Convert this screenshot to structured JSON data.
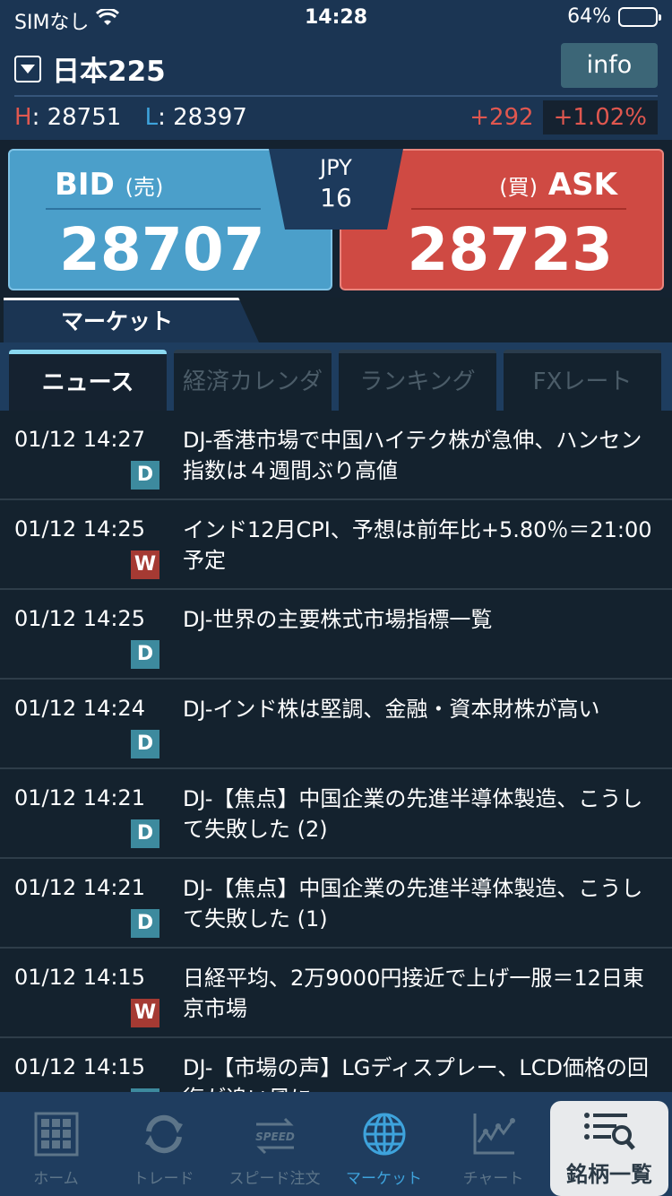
{
  "status_bar": {
    "carrier": "SIMなし",
    "time": "14:28",
    "battery_pct": "64%",
    "battery_level": 0.64
  },
  "header": {
    "instrument": "日本225",
    "info_label": "info",
    "high_label": "H",
    "high_value": "28751",
    "low_label": "L",
    "low_value": "28397",
    "change": "+292",
    "change_pct": "+1.02%"
  },
  "quote": {
    "bid_label": "BID",
    "bid_sub": "(売)",
    "bid_price": "28707",
    "ask_label": "ASK",
    "ask_sub": "(買)",
    "ask_price": "28723",
    "currency": "JPY",
    "spread": "16"
  },
  "market_tab": "マーケット",
  "subtabs": [
    {
      "label": "ニュース",
      "active": true
    },
    {
      "label": "経済カレンダー",
      "active": false
    },
    {
      "label": "ランキング",
      "active": false
    },
    {
      "label": "FXレート",
      "active": false
    }
  ],
  "news": [
    {
      "time": "01/12 14:27",
      "src": "D",
      "headline": "DJ-香港市場で中国ハイテク株が急伸、ハンセン指数は４週間ぶり高値"
    },
    {
      "time": "01/12 14:25",
      "src": "W",
      "headline": "インド12月CPI、予想は前年比+5.80％＝21:00予定"
    },
    {
      "time": "01/12 14:25",
      "src": "D",
      "headline": "DJ-世界の主要株式市場指標一覧"
    },
    {
      "time": "01/12 14:24",
      "src": "D",
      "headline": "DJ-インド株は堅調、金融・資本財株が高い"
    },
    {
      "time": "01/12 14:21",
      "src": "D",
      "headline": "DJ-【焦点】中国企業の先進半導体製造、こうして失敗した (2)"
    },
    {
      "time": "01/12 14:21",
      "src": "D",
      "headline": "DJ-【焦点】中国企業の先進半導体製造、こうして失敗した (1)"
    },
    {
      "time": "01/12 14:15",
      "src": "W",
      "headline": "日経平均、2万9000円接近で上げ一服＝12日東京市場"
    },
    {
      "time": "01/12 14:15",
      "src": "D",
      "headline": "DJ-【市場の声】LGディスプレー、LCD価格の回復が追い風に"
    }
  ],
  "bottom_nav": [
    {
      "label": "ホーム",
      "icon": "home-grid-icon"
    },
    {
      "label": "トレード",
      "icon": "refresh-icon"
    },
    {
      "label": "スピード注文",
      "icon": "speed-icon"
    },
    {
      "label": "マーケット",
      "icon": "globe-icon"
    },
    {
      "label": "チャート",
      "icon": "chart-icon"
    },
    {
      "label": "銘柄一覧",
      "icon": "list-search-icon"
    }
  ],
  "colors": {
    "header_bg": "#1b3553",
    "bid": "#4b9fca",
    "ask": "#cf4a43",
    "accent": "#3ea3dc"
  }
}
